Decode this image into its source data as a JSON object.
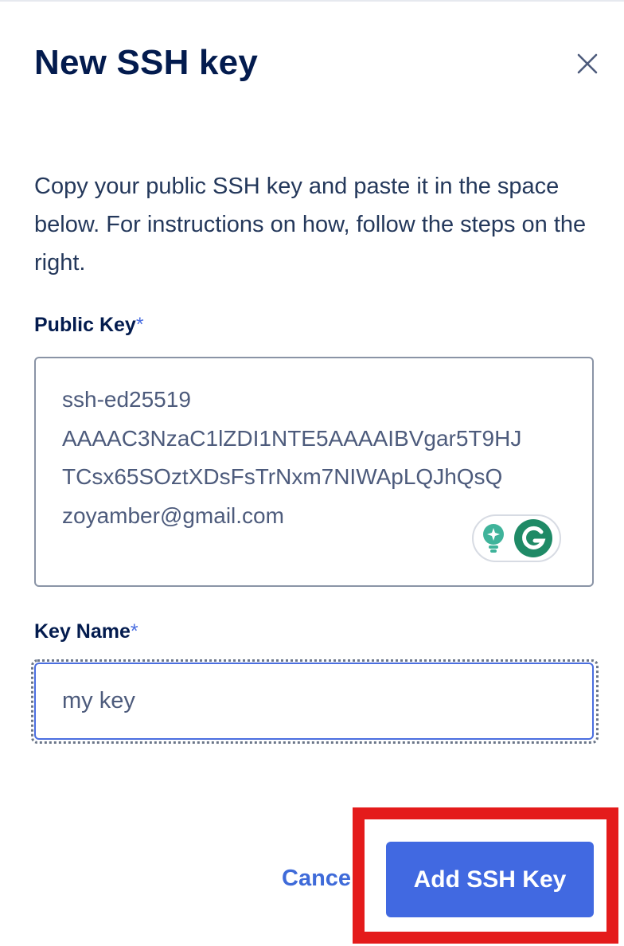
{
  "modal": {
    "title": "New SSH key",
    "close_icon": "close-icon"
  },
  "intro_text": "Copy your public SSH key and paste it in the space below. For instructions on how, follow the steps on the right.",
  "public_key": {
    "label": "Public Key",
    "required_mark": "*",
    "value_lines": [
      "ssh-ed25519",
      "AAAAC3NzaC1lZDI1NTE5AAAAIBVgar5T9HJ",
      "TCsx65SOztXDsFsTrNxm7NIWApLQJhQsQ",
      "zoyamber@gmail.com"
    ]
  },
  "key_name": {
    "label": "Key Name",
    "required_mark": "*",
    "value": "my key"
  },
  "actions": {
    "cancel_label": "Cance",
    "add_label": "Add SSH Key"
  },
  "colors": {
    "primary": "#4169e1",
    "title": "#031b4e",
    "highlight": "#e41b1b",
    "required": "#4a6ee0"
  }
}
